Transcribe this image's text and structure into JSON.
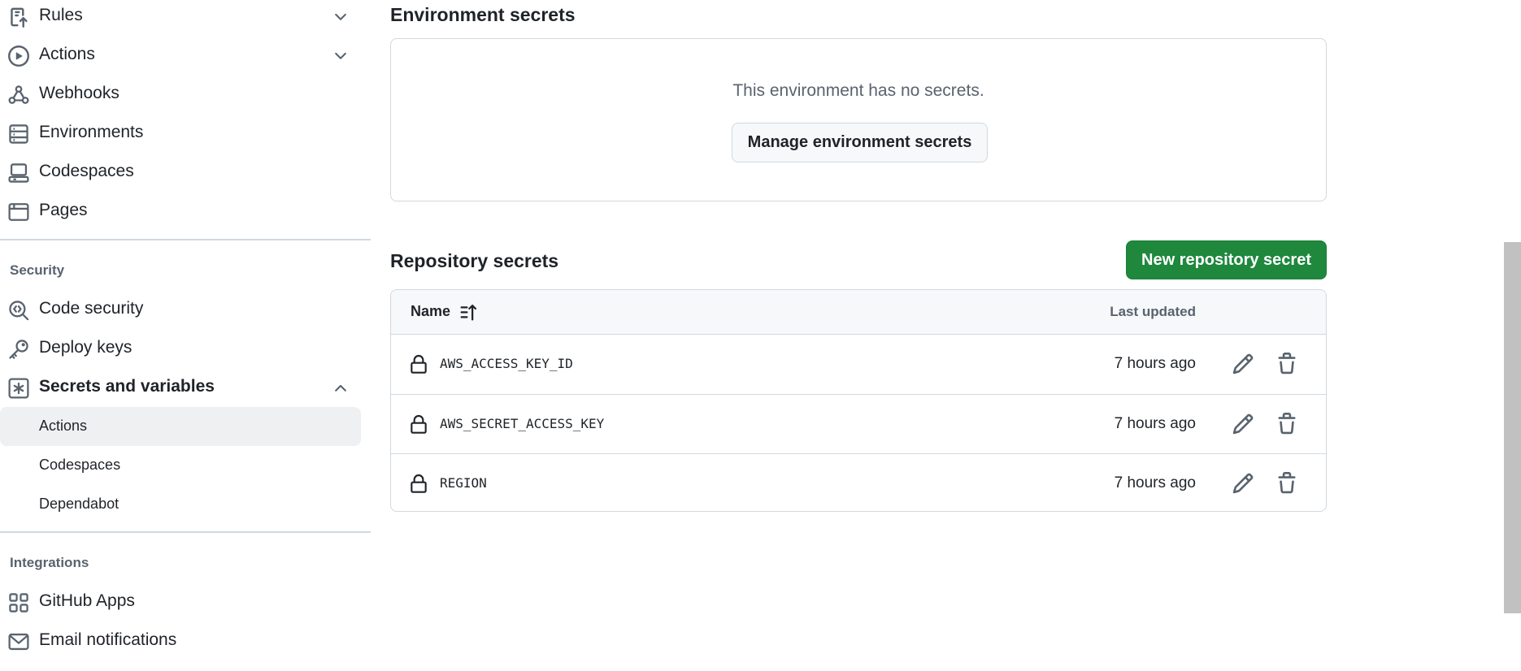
{
  "sidebar": {
    "items": [
      {
        "label": "Rules",
        "icon": "rules-icon"
      },
      {
        "label": "Actions",
        "icon": "play-icon"
      },
      {
        "label": "Webhooks",
        "icon": "webhook-icon"
      },
      {
        "label": "Environments",
        "icon": "server-icon"
      },
      {
        "label": "Codespaces",
        "icon": "codespaces-icon"
      },
      {
        "label": "Pages",
        "icon": "browser-icon"
      }
    ],
    "security_heading": "Security",
    "security_items": [
      {
        "label": "Code security",
        "icon": "codescan-icon"
      },
      {
        "label": "Deploy keys",
        "icon": "key-icon"
      },
      {
        "label": "Secrets and variables",
        "icon": "asterisk-icon"
      }
    ],
    "secrets_subitems": [
      {
        "label": "Actions",
        "active": true
      },
      {
        "label": "Codespaces",
        "active": false
      },
      {
        "label": "Dependabot",
        "active": false
      }
    ],
    "integrations_heading": "Integrations",
    "integrations_items": [
      {
        "label": "GitHub Apps",
        "icon": "apps-icon"
      },
      {
        "label": "Email notifications",
        "icon": "mail-icon"
      }
    ]
  },
  "environment_secrets": {
    "title": "Environment secrets",
    "empty_message": "This environment has no secrets.",
    "manage_button": "Manage environment secrets"
  },
  "repository_secrets": {
    "title": "Repository secrets",
    "new_button": "New repository secret",
    "columns": {
      "name": "Name",
      "last_updated": "Last updated"
    },
    "rows": [
      {
        "name": "AWS_ACCESS_KEY_ID",
        "updated": "7 hours ago"
      },
      {
        "name": "AWS_SECRET_ACCESS_KEY",
        "updated": "7 hours ago"
      },
      {
        "name": "REGION",
        "updated": "7 hours ago"
      }
    ]
  },
  "colors": {
    "primary_button": "#1f883d",
    "border": "#d1d9e0",
    "muted_text": "#59636e",
    "active_nav_bg": "#eef0f2"
  }
}
